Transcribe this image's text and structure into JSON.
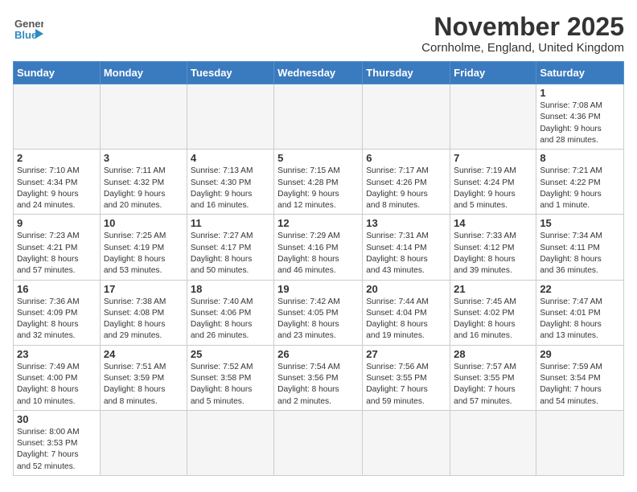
{
  "header": {
    "logo_general": "General",
    "logo_blue": "Blue",
    "title": "November 2025",
    "subtitle": "Cornholme, England, United Kingdom"
  },
  "days_of_week": [
    "Sunday",
    "Monday",
    "Tuesday",
    "Wednesday",
    "Thursday",
    "Friday",
    "Saturday"
  ],
  "weeks": [
    [
      {
        "day": "",
        "info": ""
      },
      {
        "day": "",
        "info": ""
      },
      {
        "day": "",
        "info": ""
      },
      {
        "day": "",
        "info": ""
      },
      {
        "day": "",
        "info": ""
      },
      {
        "day": "",
        "info": ""
      },
      {
        "day": "1",
        "info": "Sunrise: 7:08 AM\nSunset: 4:36 PM\nDaylight: 9 hours\nand 28 minutes."
      }
    ],
    [
      {
        "day": "2",
        "info": "Sunrise: 7:10 AM\nSunset: 4:34 PM\nDaylight: 9 hours\nand 24 minutes."
      },
      {
        "day": "3",
        "info": "Sunrise: 7:11 AM\nSunset: 4:32 PM\nDaylight: 9 hours\nand 20 minutes."
      },
      {
        "day": "4",
        "info": "Sunrise: 7:13 AM\nSunset: 4:30 PM\nDaylight: 9 hours\nand 16 minutes."
      },
      {
        "day": "5",
        "info": "Sunrise: 7:15 AM\nSunset: 4:28 PM\nDaylight: 9 hours\nand 12 minutes."
      },
      {
        "day": "6",
        "info": "Sunrise: 7:17 AM\nSunset: 4:26 PM\nDaylight: 9 hours\nand 8 minutes."
      },
      {
        "day": "7",
        "info": "Sunrise: 7:19 AM\nSunset: 4:24 PM\nDaylight: 9 hours\nand 5 minutes."
      },
      {
        "day": "8",
        "info": "Sunrise: 7:21 AM\nSunset: 4:22 PM\nDaylight: 9 hours\nand 1 minute."
      }
    ],
    [
      {
        "day": "9",
        "info": "Sunrise: 7:23 AM\nSunset: 4:21 PM\nDaylight: 8 hours\nand 57 minutes."
      },
      {
        "day": "10",
        "info": "Sunrise: 7:25 AM\nSunset: 4:19 PM\nDaylight: 8 hours\nand 53 minutes."
      },
      {
        "day": "11",
        "info": "Sunrise: 7:27 AM\nSunset: 4:17 PM\nDaylight: 8 hours\nand 50 minutes."
      },
      {
        "day": "12",
        "info": "Sunrise: 7:29 AM\nSunset: 4:16 PM\nDaylight: 8 hours\nand 46 minutes."
      },
      {
        "day": "13",
        "info": "Sunrise: 7:31 AM\nSunset: 4:14 PM\nDaylight: 8 hours\nand 43 minutes."
      },
      {
        "day": "14",
        "info": "Sunrise: 7:33 AM\nSunset: 4:12 PM\nDaylight: 8 hours\nand 39 minutes."
      },
      {
        "day": "15",
        "info": "Sunrise: 7:34 AM\nSunset: 4:11 PM\nDaylight: 8 hours\nand 36 minutes."
      }
    ],
    [
      {
        "day": "16",
        "info": "Sunrise: 7:36 AM\nSunset: 4:09 PM\nDaylight: 8 hours\nand 32 minutes."
      },
      {
        "day": "17",
        "info": "Sunrise: 7:38 AM\nSunset: 4:08 PM\nDaylight: 8 hours\nand 29 minutes."
      },
      {
        "day": "18",
        "info": "Sunrise: 7:40 AM\nSunset: 4:06 PM\nDaylight: 8 hours\nand 26 minutes."
      },
      {
        "day": "19",
        "info": "Sunrise: 7:42 AM\nSunset: 4:05 PM\nDaylight: 8 hours\nand 23 minutes."
      },
      {
        "day": "20",
        "info": "Sunrise: 7:44 AM\nSunset: 4:04 PM\nDaylight: 8 hours\nand 19 minutes."
      },
      {
        "day": "21",
        "info": "Sunrise: 7:45 AM\nSunset: 4:02 PM\nDaylight: 8 hours\nand 16 minutes."
      },
      {
        "day": "22",
        "info": "Sunrise: 7:47 AM\nSunset: 4:01 PM\nDaylight: 8 hours\nand 13 minutes."
      }
    ],
    [
      {
        "day": "23",
        "info": "Sunrise: 7:49 AM\nSunset: 4:00 PM\nDaylight: 8 hours\nand 10 minutes."
      },
      {
        "day": "24",
        "info": "Sunrise: 7:51 AM\nSunset: 3:59 PM\nDaylight: 8 hours\nand 8 minutes."
      },
      {
        "day": "25",
        "info": "Sunrise: 7:52 AM\nSunset: 3:58 PM\nDaylight: 8 hours\nand 5 minutes."
      },
      {
        "day": "26",
        "info": "Sunrise: 7:54 AM\nSunset: 3:56 PM\nDaylight: 8 hours\nand 2 minutes."
      },
      {
        "day": "27",
        "info": "Sunrise: 7:56 AM\nSunset: 3:55 PM\nDaylight: 7 hours\nand 59 minutes."
      },
      {
        "day": "28",
        "info": "Sunrise: 7:57 AM\nSunset: 3:55 PM\nDaylight: 7 hours\nand 57 minutes."
      },
      {
        "day": "29",
        "info": "Sunrise: 7:59 AM\nSunset: 3:54 PM\nDaylight: 7 hours\nand 54 minutes."
      }
    ],
    [
      {
        "day": "30",
        "info": "Sunrise: 8:00 AM\nSunset: 3:53 PM\nDaylight: 7 hours\nand 52 minutes."
      },
      {
        "day": "",
        "info": ""
      },
      {
        "day": "",
        "info": ""
      },
      {
        "day": "",
        "info": ""
      },
      {
        "day": "",
        "info": ""
      },
      {
        "day": "",
        "info": ""
      },
      {
        "day": "",
        "info": ""
      }
    ]
  ]
}
